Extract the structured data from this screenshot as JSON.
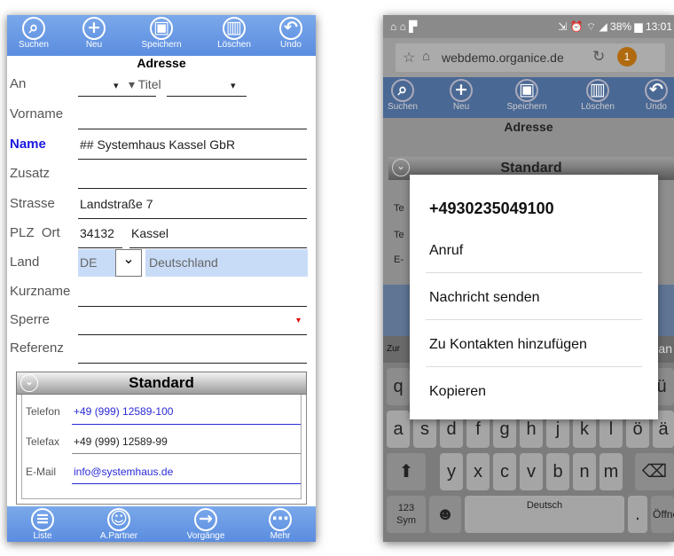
{
  "colors": {
    "toolbar": "#6896e4",
    "link": "#2a2ad8",
    "land_bg": "#c9dcf7",
    "required_label": "#1a1ae0"
  },
  "left": {
    "toolbar": [
      {
        "icon": "search-icon",
        "glyph": "⌕",
        "label": "Suchen"
      },
      {
        "icon": "plus-icon",
        "glyph": "+",
        "label": "Neu"
      },
      {
        "icon": "save-icon",
        "glyph": "▣",
        "label": "Speichern"
      },
      {
        "icon": "trash-icon",
        "glyph": "▥",
        "label": "Löschen"
      },
      {
        "icon": "undo-icon",
        "glyph": "↶",
        "label": "Undo"
      }
    ],
    "title": "Adresse",
    "fields": {
      "an": {
        "label": "An",
        "value": "▾",
        "titel": "▾ Titel",
        "titel_caret": "▾"
      },
      "vorname": {
        "label": "Vorname",
        "value": ""
      },
      "name": {
        "label": "Name",
        "value": "## Systemhaus Kassel GbR"
      },
      "zusatz": {
        "label": "Zusatz",
        "value": ""
      },
      "strasse": {
        "label": "Strasse",
        "value": "Landstraße 7"
      },
      "plz_ort": {
        "label": "PLZ  Ort",
        "plz": "34132",
        "ort": "Kassel"
      },
      "land": {
        "label": "Land",
        "code": "DE",
        "name": "Deutschland",
        "dropdown": "⌄"
      },
      "kurzname": {
        "label": "Kurzname",
        "value": ""
      },
      "sperre": {
        "label": "Sperre",
        "value": "",
        "caret": "▾"
      },
      "referenz": {
        "label": "Referenz",
        "value": ""
      }
    },
    "section": {
      "title": "Standard",
      "chevron": "⌄"
    },
    "contact": [
      {
        "label": "Telefon",
        "value": "+49 (999) 12589-100"
      },
      {
        "label": "Telefax",
        "value": "+49 (999) 12589-99"
      },
      {
        "label": "E-Mail",
        "value": "info@systemhaus.de"
      }
    ],
    "bottom": [
      {
        "icon": "list-icon",
        "glyph": "≡",
        "label": "Liste"
      },
      {
        "icon": "partner-icon",
        "glyph": "☺",
        "label": "A.Partner"
      },
      {
        "icon": "arrow-right-icon",
        "glyph": "→",
        "label": "Vorgänge"
      },
      {
        "icon": "more-icon",
        "glyph": "⋯",
        "label": "Mehr"
      }
    ]
  },
  "right": {
    "status": {
      "left": "⌂ ⌂ ▛",
      "right": "⇲ ⏰ ⌔ ◢ 38% ▆ 13:01"
    },
    "url": "webdemo.organice.de",
    "badge": "1",
    "toolbar": [
      {
        "label": "Suchen"
      },
      {
        "label": "Neu"
      },
      {
        "label": "Speichern"
      },
      {
        "label": "Löschen"
      },
      {
        "label": "Undo"
      }
    ],
    "title": "Adresse",
    "section": "Standard",
    "peek": {
      "te1": "Te",
      "te2": "Te",
      "e": "E-",
      "zur": "Zur",
      "an": "an"
    },
    "popup": {
      "phone": "+4930235049100",
      "items": [
        "Anruf",
        "Nachricht senden",
        "Zu Kontakten hinzufügen",
        "Kopieren"
      ]
    },
    "keyboard": {
      "row1": [
        "q",
        "ü"
      ],
      "row2": [
        "a",
        "s",
        "d",
        "f",
        "g",
        "h",
        "j",
        "k",
        "l",
        "ö",
        "ä"
      ],
      "row3": [
        "y",
        "x",
        "c",
        "v",
        "b",
        "n",
        "m"
      ],
      "shift": "⬆",
      "backspace": "⌫",
      "sym": "123\nSym",
      "emoji": "☻",
      "space": "Deutsch",
      "period": ".",
      "enter": "Öffnen"
    }
  }
}
